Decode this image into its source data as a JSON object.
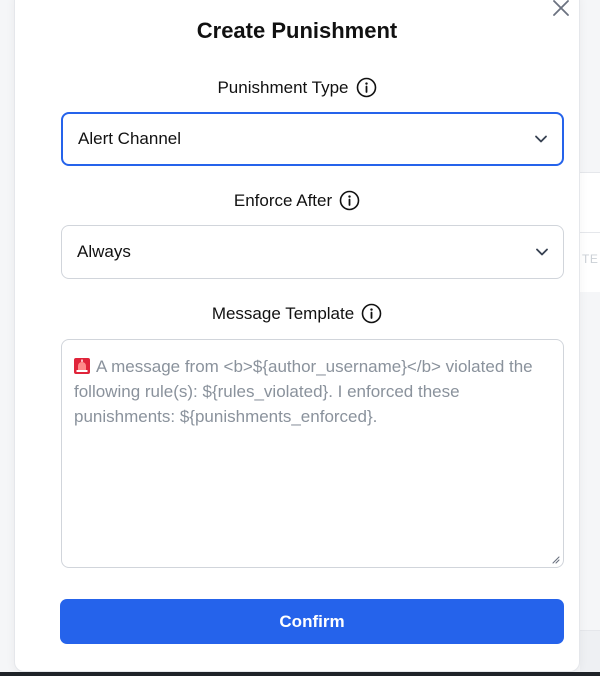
{
  "modal": {
    "title": "Create Punishment",
    "close_icon": "close-icon",
    "confirm_label": "Confirm"
  },
  "fields": {
    "punishment_type": {
      "label": "Punishment Type",
      "value": "Alert Channel",
      "info_icon": "info-icon"
    },
    "enforce_after": {
      "label": "Enforce After",
      "value": "Always",
      "info_icon": "info-icon"
    },
    "message_template": {
      "label": "Message Template",
      "placeholder": "A message from <b>${author_username}</b> violated the following rule(s): ${rules_violated}. I enforced these punishments: ${punishments_enforced}.",
      "prefix_icon": "siren-emoji-icon",
      "info_icon": "info-icon"
    }
  },
  "background": {
    "peek_text": "TE"
  },
  "colors": {
    "accent": "#2563eb",
    "placeholder": "#8a929c",
    "border": "#d1d5db"
  }
}
